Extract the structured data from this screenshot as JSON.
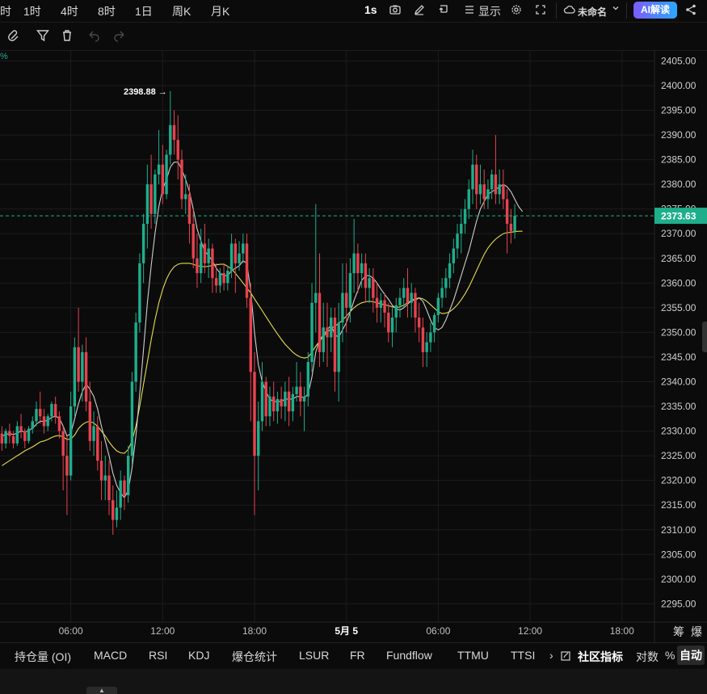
{
  "topbar": {
    "timeframes": [
      "时",
      "1时",
      "4时",
      "8时",
      "1日",
      "周K",
      "月K"
    ],
    "active_interval": "1s",
    "display_label": "显示",
    "layout_name": "未命名",
    "ai_label": "AI解读"
  },
  "bottombar": {
    "tabs": [
      "持仓量 (OI)",
      "MACD",
      "RSI",
      "KDJ",
      "爆仓统计",
      "LSUR",
      "FR",
      "Fundflow",
      "TTMU",
      "TTSI"
    ],
    "more_arrow": "›",
    "community_label": "社区指标",
    "log_label": "对数",
    "percent_label": "%",
    "auto_label": "自动",
    "extra_right": [
      "筹",
      "爆"
    ]
  },
  "colors": {
    "up": "#1fae8c",
    "down": "#e8424f",
    "ma_fast": "#cfcfcf",
    "ma_slow": "#e6dc4a",
    "price_line": "#1fae8c",
    "grid": "#1c1c1c",
    "background": "#0b0b0b"
  },
  "chart_data": {
    "type": "candlestick",
    "pct_marker": "%",
    "y_ticks": [
      2405.0,
      2400.0,
      2395.0,
      2390.0,
      2385.0,
      2380.0,
      2375.0,
      2370.0,
      2365.0,
      2360.0,
      2355.0,
      2350.0,
      2345.0,
      2340.0,
      2335.0,
      2330.0,
      2325.0,
      2320.0,
      2315.0,
      2310.0,
      2305.0,
      2300.0,
      2295.0
    ],
    "y_tick_labels": [
      "2405.00",
      "2400.00",
      "2395.00",
      "2390.00",
      "2385.00",
      "2380.00",
      "2375.00",
      "2370.00",
      "2365.00",
      "2360.00",
      "2355.00",
      "2350.00",
      "2345.00",
      "2340.00",
      "2335.00",
      "2330.00",
      "2325.00",
      "2320.00",
      "2315.00",
      "2310.00",
      "2305.00",
      "2300.00",
      "2295.00"
    ],
    "ylim": [
      2291.3,
      2407.2
    ],
    "x_tick_labels": [
      "06:00",
      "12:00",
      "18:00",
      "5月 5",
      "06:00",
      "12:00",
      "18:00"
    ],
    "x_tick_slots": [
      18,
      42,
      66,
      90,
      114,
      138,
      162
    ],
    "total_slots": 171,
    "current_price": 2373.63,
    "current_price_label": "2373.63",
    "high_marker": {
      "label": "2398.88 →",
      "slot": 44,
      "value": 2398.88
    },
    "candles": [
      {
        "o": 2329.5,
        "h": 2331.0,
        "c": 2327.5,
        "l": 2326.0
      },
      {
        "o": 2327.5,
        "h": 2330.5,
        "c": 2330.0,
        "l": 2326.5
      },
      {
        "o": 2330.0,
        "h": 2331.5,
        "c": 2329.0,
        "l": 2327.5
      },
      {
        "o": 2329.0,
        "h": 2330.0,
        "c": 2327.5,
        "l": 2326.5
      },
      {
        "o": 2327.5,
        "h": 2332.0,
        "c": 2331.0,
        "l": 2327.0
      },
      {
        "o": 2331.0,
        "h": 2333.5,
        "c": 2330.0,
        "l": 2328.5
      },
      {
        "o": 2330.0,
        "h": 2330.5,
        "c": 2328.0,
        "l": 2326.5
      },
      {
        "o": 2328.0,
        "h": 2331.0,
        "c": 2330.5,
        "l": 2327.5
      },
      {
        "o": 2330.5,
        "h": 2333.0,
        "c": 2332.0,
        "l": 2329.5
      },
      {
        "o": 2332.0,
        "h": 2336.0,
        "c": 2334.5,
        "l": 2331.0
      },
      {
        "o": 2334.5,
        "h": 2338.0,
        "c": 2333.0,
        "l": 2331.5
      },
      {
        "o": 2333.0,
        "h": 2334.5,
        "c": 2331.0,
        "l": 2329.5
      },
      {
        "o": 2331.0,
        "h": 2333.5,
        "c": 2333.0,
        "l": 2330.0
      },
      {
        "o": 2333.0,
        "h": 2336.0,
        "c": 2335.5,
        "l": 2332.0
      },
      {
        "o": 2335.5,
        "h": 2337.0,
        "c": 2333.0,
        "l": 2331.5
      },
      {
        "o": 2333.0,
        "h": 2334.0,
        "c": 2330.0,
        "l": 2328.5
      },
      {
        "o": 2330.0,
        "h": 2331.0,
        "c": 2325.0,
        "l": 2318.0
      },
      {
        "o": 2325.0,
        "h": 2329.0,
        "c": 2321.0,
        "l": 2313.0
      },
      {
        "o": 2321.0,
        "h": 2338.0,
        "c": 2335.0,
        "l": 2320.0
      },
      {
        "o": 2335.0,
        "h": 2349.0,
        "c": 2347.0,
        "l": 2333.0
      },
      {
        "o": 2347.0,
        "h": 2355.0,
        "c": 2340.0,
        "l": 2338.0
      },
      {
        "o": 2340.0,
        "h": 2347.5,
        "c": 2346.0,
        "l": 2336.0
      },
      {
        "o": 2346.0,
        "h": 2349.0,
        "c": 2336.0,
        "l": 2334.0
      },
      {
        "o": 2336.0,
        "h": 2340.0,
        "c": 2328.0,
        "l": 2326.0
      },
      {
        "o": 2328.0,
        "h": 2334.0,
        "c": 2331.0,
        "l": 2325.0
      },
      {
        "o": 2331.0,
        "h": 2333.0,
        "c": 2324.0,
        "l": 2322.0
      },
      {
        "o": 2324.0,
        "h": 2328.0,
        "c": 2320.0,
        "l": 2316.0
      },
      {
        "o": 2320.0,
        "h": 2325.0,
        "c": 2321.0,
        "l": 2316.0
      },
      {
        "o": 2321.0,
        "h": 2324.0,
        "c": 2316.0,
        "l": 2313.0
      },
      {
        "o": 2316.0,
        "h": 2319.0,
        "c": 2312.0,
        "l": 2309.0
      },
      {
        "o": 2312.0,
        "h": 2318.0,
        "c": 2314.5,
        "l": 2310.5
      },
      {
        "o": 2314.5,
        "h": 2322.0,
        "c": 2320.0,
        "l": 2312.0
      },
      {
        "o": 2320.0,
        "h": 2321.0,
        "c": 2317.0,
        "l": 2314.0
      },
      {
        "o": 2317.0,
        "h": 2327.0,
        "c": 2325.0,
        "l": 2315.5
      },
      {
        "o": 2325.0,
        "h": 2342.0,
        "c": 2340.0,
        "l": 2323.0
      },
      {
        "o": 2340.0,
        "h": 2354.0,
        "c": 2352.0,
        "l": 2338.0
      },
      {
        "o": 2352.0,
        "h": 2366.0,
        "c": 2364.0,
        "l": 2350.0
      },
      {
        "o": 2364.0,
        "h": 2374.0,
        "c": 2372.0,
        "l": 2360.0
      },
      {
        "o": 2372.0,
        "h": 2384.0,
        "c": 2380.0,
        "l": 2367.0
      },
      {
        "o": 2380.0,
        "h": 2386.0,
        "c": 2374.0,
        "l": 2371.0
      },
      {
        "o": 2374.0,
        "h": 2383.0,
        "c": 2382.0,
        "l": 2372.0
      },
      {
        "o": 2382.0,
        "h": 2391.0,
        "c": 2384.0,
        "l": 2380.0
      },
      {
        "o": 2384.0,
        "h": 2388.0,
        "c": 2378.0,
        "l": 2376.0
      },
      {
        "o": 2378.0,
        "h": 2387.0,
        "c": 2386.0,
        "l": 2377.0
      },
      {
        "o": 2386.0,
        "h": 2398.88,
        "c": 2392.0,
        "l": 2384.0
      },
      {
        "o": 2392.0,
        "h": 2395.0,
        "c": 2389.0,
        "l": 2386.0
      },
      {
        "o": 2389.0,
        "h": 2394.0,
        "c": 2385.0,
        "l": 2381.0
      },
      {
        "o": 2385.0,
        "h": 2387.0,
        "c": 2377.0,
        "l": 2375.0
      },
      {
        "o": 2377.0,
        "h": 2382.0,
        "c": 2378.0,
        "l": 2374.0
      },
      {
        "o": 2378.0,
        "h": 2380.0,
        "c": 2372.0,
        "l": 2368.0
      },
      {
        "o": 2372.0,
        "h": 2375.0,
        "c": 2365.0,
        "l": 2363.0
      },
      {
        "o": 2365.0,
        "h": 2370.0,
        "c": 2362.0,
        "l": 2359.0
      },
      {
        "o": 2362.0,
        "h": 2371.0,
        "c": 2368.0,
        "l": 2360.0
      },
      {
        "o": 2368.0,
        "h": 2372.0,
        "c": 2364.0,
        "l": 2362.0
      },
      {
        "o": 2364.0,
        "h": 2369.0,
        "c": 2367.0,
        "l": 2361.0
      },
      {
        "o": 2367.0,
        "h": 2368.0,
        "c": 2361.0,
        "l": 2358.0
      },
      {
        "o": 2361.0,
        "h": 2364.0,
        "c": 2359.5,
        "l": 2358.0
      },
      {
        "o": 2359.5,
        "h": 2363.0,
        "c": 2362.0,
        "l": 2358.0
      },
      {
        "o": 2362.0,
        "h": 2364.0,
        "c": 2360.0,
        "l": 2358.5
      },
      {
        "o": 2360.0,
        "h": 2363.5,
        "c": 2362.5,
        "l": 2358.5
      },
      {
        "o": 2362.5,
        "h": 2370.0,
        "c": 2368.0,
        "l": 2361.0
      },
      {
        "o": 2368.0,
        "h": 2369.0,
        "c": 2364.0,
        "l": 2358.0
      },
      {
        "o": 2364.0,
        "h": 2368.5,
        "c": 2366.0,
        "l": 2362.5
      },
      {
        "o": 2366.0,
        "h": 2370.0,
        "c": 2368.0,
        "l": 2364.0
      },
      {
        "o": 2368.0,
        "h": 2370.0,
        "c": 2357.0,
        "l": 2355.0
      },
      {
        "o": 2357.0,
        "h": 2360.0,
        "c": 2342.0,
        "l": 2332.0
      },
      {
        "o": 2342.0,
        "h": 2346.0,
        "c": 2325.0,
        "l": 2313.0
      },
      {
        "o": 2325.0,
        "h": 2336.0,
        "c": 2332.0,
        "l": 2318.0
      },
      {
        "o": 2332.0,
        "h": 2344.0,
        "c": 2340.0,
        "l": 2330.0
      },
      {
        "o": 2340.0,
        "h": 2341.0,
        "c": 2333.0,
        "l": 2331.0
      },
      {
        "o": 2333.0,
        "h": 2339.0,
        "c": 2337.0,
        "l": 2331.0
      },
      {
        "o": 2337.0,
        "h": 2340.0,
        "c": 2334.0,
        "l": 2332.0
      },
      {
        "o": 2334.0,
        "h": 2338.0,
        "c": 2336.5,
        "l": 2331.5
      },
      {
        "o": 2336.5,
        "h": 2339.0,
        "c": 2335.0,
        "l": 2332.5
      },
      {
        "o": 2335.0,
        "h": 2340.0,
        "c": 2338.0,
        "l": 2332.0
      },
      {
        "o": 2338.0,
        "h": 2341.0,
        "c": 2334.0,
        "l": 2331.0
      },
      {
        "o": 2334.0,
        "h": 2339.0,
        "c": 2337.5,
        "l": 2332.0
      },
      {
        "o": 2337.5,
        "h": 2344.0,
        "c": 2339.0,
        "l": 2336.0
      },
      {
        "o": 2339.0,
        "h": 2342.0,
        "c": 2336.0,
        "l": 2333.0
      },
      {
        "o": 2336.0,
        "h": 2339.0,
        "c": 2337.0,
        "l": 2330.0
      },
      {
        "o": 2337.0,
        "h": 2346.0,
        "c": 2344.0,
        "l": 2335.0
      },
      {
        "o": 2344.0,
        "h": 2360.0,
        "c": 2356.0,
        "l": 2342.0
      },
      {
        "o": 2356.0,
        "h": 2376.0,
        "c": 2358.0,
        "l": 2350.0
      },
      {
        "o": 2358.0,
        "h": 2366.0,
        "c": 2346.0,
        "l": 2343.0
      },
      {
        "o": 2346.0,
        "h": 2356.0,
        "c": 2351.0,
        "l": 2344.0
      },
      {
        "o": 2351.0,
        "h": 2356.0,
        "c": 2349.0,
        "l": 2343.0
      },
      {
        "o": 2349.0,
        "h": 2355.0,
        "c": 2353.0,
        "l": 2346.0
      },
      {
        "o": 2353.0,
        "h": 2355.0,
        "c": 2342.0,
        "l": 2338.0
      },
      {
        "o": 2342.0,
        "h": 2356.0,
        "c": 2352.0,
        "l": 2336.0
      },
      {
        "o": 2352.0,
        "h": 2364.0,
        "c": 2358.0,
        "l": 2348.0
      },
      {
        "o": 2358.0,
        "h": 2364.0,
        "c": 2355.0,
        "l": 2350.0
      },
      {
        "o": 2355.0,
        "h": 2365.0,
        "c": 2362.0,
        "l": 2352.0
      },
      {
        "o": 2362.0,
        "h": 2373.0,
        "c": 2366.0,
        "l": 2358.0
      },
      {
        "o": 2366.0,
        "h": 2368.0,
        "c": 2362.0,
        "l": 2358.0
      },
      {
        "o": 2362.0,
        "h": 2366.0,
        "c": 2364.0,
        "l": 2359.0
      },
      {
        "o": 2364.0,
        "h": 2366.0,
        "c": 2359.0,
        "l": 2356.0
      },
      {
        "o": 2359.0,
        "h": 2363.0,
        "c": 2361.0,
        "l": 2356.0
      },
      {
        "o": 2361.0,
        "h": 2363.0,
        "c": 2357.0,
        "l": 2354.0
      },
      {
        "o": 2357.0,
        "h": 2360.0,
        "c": 2355.0,
        "l": 2352.0
      },
      {
        "o": 2355.0,
        "h": 2358.0,
        "c": 2356.5,
        "l": 2352.0
      },
      {
        "o": 2356.5,
        "h": 2358.0,
        "c": 2354.0,
        "l": 2351.0
      },
      {
        "o": 2354.0,
        "h": 2356.0,
        "c": 2350.0,
        "l": 2348.0
      },
      {
        "o": 2350.0,
        "h": 2355.0,
        "c": 2353.0,
        "l": 2347.0
      },
      {
        "o": 2353.0,
        "h": 2357.0,
        "c": 2355.5,
        "l": 2350.0
      },
      {
        "o": 2355.5,
        "h": 2359.0,
        "c": 2357.0,
        "l": 2353.0
      },
      {
        "o": 2357.0,
        "h": 2361.0,
        "c": 2359.0,
        "l": 2355.0
      },
      {
        "o": 2359.0,
        "h": 2363.0,
        "c": 2356.0,
        "l": 2353.0
      },
      {
        "o": 2356.0,
        "h": 2360.0,
        "c": 2358.0,
        "l": 2353.0
      },
      {
        "o": 2358.0,
        "h": 2359.0,
        "c": 2353.0,
        "l": 2350.0
      },
      {
        "o": 2353.0,
        "h": 2356.0,
        "c": 2351.0,
        "l": 2348.0
      },
      {
        "o": 2351.0,
        "h": 2353.0,
        "c": 2346.0,
        "l": 2343.0
      },
      {
        "o": 2346.0,
        "h": 2350.0,
        "c": 2348.0,
        "l": 2343.0
      },
      {
        "o": 2348.0,
        "h": 2352.0,
        "c": 2350.0,
        "l": 2346.0
      },
      {
        "o": 2350.0,
        "h": 2354.0,
        "c": 2353.5,
        "l": 2348.0
      },
      {
        "o": 2353.5,
        "h": 2358.0,
        "c": 2357.0,
        "l": 2352.0
      },
      {
        "o": 2357.0,
        "h": 2361.0,
        "c": 2359.0,
        "l": 2355.0
      },
      {
        "o": 2359.0,
        "h": 2363.0,
        "c": 2361.0,
        "l": 2357.0
      },
      {
        "o": 2361.0,
        "h": 2366.0,
        "c": 2364.0,
        "l": 2359.0
      },
      {
        "o": 2364.0,
        "h": 2369.0,
        "c": 2367.0,
        "l": 2362.0
      },
      {
        "o": 2367.0,
        "h": 2372.0,
        "c": 2370.0,
        "l": 2365.0
      },
      {
        "o": 2370.0,
        "h": 2375.0,
        "c": 2372.0,
        "l": 2366.0
      },
      {
        "o": 2372.0,
        "h": 2377.0,
        "c": 2375.0,
        "l": 2370.0
      },
      {
        "o": 2375.0,
        "h": 2381.0,
        "c": 2379.0,
        "l": 2373.0
      },
      {
        "o": 2379.0,
        "h": 2387.0,
        "c": 2384.0,
        "l": 2376.0
      },
      {
        "o": 2384.0,
        "h": 2386.0,
        "c": 2378.0,
        "l": 2375.0
      },
      {
        "o": 2378.0,
        "h": 2384.0,
        "c": 2380.0,
        "l": 2376.0
      },
      {
        "o": 2380.0,
        "h": 2383.0,
        "c": 2377.0,
        "l": 2375.0
      },
      {
        "o": 2377.0,
        "h": 2381.0,
        "c": 2379.0,
        "l": 2375.0
      },
      {
        "o": 2379.0,
        "h": 2383.0,
        "c": 2382.0,
        "l": 2377.0
      },
      {
        "o": 2382.0,
        "h": 2390.0,
        "c": 2378.0,
        "l": 2376.0
      },
      {
        "o": 2378.0,
        "h": 2383.0,
        "c": 2380.0,
        "l": 2376.0
      },
      {
        "o": 2380.0,
        "h": 2383.0,
        "c": 2377.0,
        "l": 2375.0
      },
      {
        "o": 2377.0,
        "h": 2379.0,
        "c": 2372.0,
        "l": 2366.0
      },
      {
        "o": 2372.0,
        "h": 2375.0,
        "c": 2370.5,
        "l": 2368.0
      },
      {
        "o": 2370.5,
        "h": 2376.0,
        "c": 2373.63,
        "l": 2369.0
      }
    ],
    "ma_fast": [
      2329.0,
      2329.3,
      2329.5,
      2329.3,
      2329.6,
      2330.0,
      2329.8,
      2330.1,
      2330.6,
      2331.4,
      2332.0,
      2332.0,
      2332.2,
      2332.8,
      2333.0,
      2332.6,
      2331.0,
      2329.0,
      2329.5,
      2332.5,
      2335.5,
      2338.0,
      2339.5,
      2338.5,
      2337.0,
      2334.5,
      2331.0,
      2328.0,
      2325.0,
      2321.5,
      2319.0,
      2317.5,
      2316.5,
      2318.0,
      2322.5,
      2329.0,
      2337.5,
      2346.5,
      2356.0,
      2363.5,
      2370.0,
      2375.5,
      2379.0,
      2381.0,
      2383.5,
      2384.5,
      2384.5,
      2383.0,
      2381.0,
      2378.5,
      2375.0,
      2371.0,
      2368.5,
      2366.5,
      2365.5,
      2364.5,
      2363.0,
      2362.0,
      2361.5,
      2361.5,
      2362.5,
      2363.0,
      2363.5,
      2364.5,
      2364.0,
      2358.5,
      2350.0,
      2343.5,
      2340.0,
      2338.0,
      2336.5,
      2336.0,
      2336.0,
      2336.0,
      2336.5,
      2336.5,
      2336.5,
      2337.0,
      2337.0,
      2336.8,
      2337.5,
      2341.0,
      2346.0,
      2348.5,
      2349.5,
      2350.5,
      2351.5,
      2349.5,
      2349.0,
      2350.5,
      2352.0,
      2354.0,
      2356.5,
      2358.5,
      2360.5,
      2361.5,
      2361.5,
      2361.0,
      2360.0,
      2358.8,
      2357.7,
      2356.7,
      2355.5,
      2354.8,
      2354.5,
      2355.0,
      2355.7,
      2356.5,
      2356.5,
      2357.0,
      2356.3,
      2354.5,
      2352.5,
      2351.0,
      2350.5,
      2351.0,
      2352.5,
      2354.5,
      2356.5,
      2359.0,
      2361.5,
      2364.0,
      2366.5,
      2369.5,
      2372.5,
      2375.0,
      2376.5,
      2378.0,
      2378.5,
      2379.0,
      2379.5,
      2380.0,
      2379.5,
      2378.5,
      2377.0,
      2375.5,
      2374.5
    ],
    "ma_slow": [
      2323.0,
      2323.5,
      2324.0,
      2324.5,
      2325.0,
      2325.5,
      2326.0,
      2326.4,
      2326.8,
      2327.3,
      2327.8,
      2328.0,
      2328.3,
      2328.7,
      2329.0,
      2329.1,
      2328.8,
      2328.3,
      2328.4,
      2329.2,
      2330.5,
      2331.3,
      2331.8,
      2332.0,
      2331.6,
      2331.0,
      2330.0,
      2329.0,
      2327.8,
      2326.8,
      2326.0,
      2325.6,
      2325.5,
      2326.3,
      2328.0,
      2331.0,
      2335.0,
      2339.5,
      2344.0,
      2348.5,
      2352.5,
      2356.0,
      2358.7,
      2360.8,
      2362.3,
      2363.3,
      2363.8,
      2364.0,
      2364.0,
      2364.0,
      2363.8,
      2363.5,
      2363.4,
      2363.3,
      2363.4,
      2363.6,
      2363.7,
      2363.8,
      2363.8,
      2363.4,
      2362.8,
      2362.0,
      2361.0,
      2360.0,
      2359.0,
      2358.0,
      2356.8,
      2355.6,
      2354.4,
      2353.2,
      2352.0,
      2350.8,
      2349.7,
      2348.6,
      2347.6,
      2346.8,
      2346.0,
      2345.4,
      2345.0,
      2344.8,
      2345.0,
      2346.0,
      2347.2,
      2348.2,
      2349.2,
      2350.0,
      2350.8,
      2351.3,
      2351.8,
      2352.5,
      2353.3,
      2354.2,
      2355.0,
      2355.6,
      2356.0,
      2356.2,
      2356.3,
      2356.2,
      2356.0,
      2355.8,
      2355.6,
      2355.4,
      2355.2,
      2355.0,
      2355.2,
      2355.5,
      2356.0,
      2356.5,
      2356.8,
      2357.0,
      2356.8,
      2356.3,
      2355.6,
      2354.9,
      2354.2,
      2353.8,
      2353.9,
      2354.2,
      2354.8,
      2355.6,
      2356.6,
      2357.8,
      2359.2,
      2360.8,
      2362.5,
      2364.2,
      2365.8,
      2367.1,
      2368.1,
      2368.9,
      2369.5,
      2370.0,
      2370.2,
      2370.3,
      2370.4,
      2370.5,
      2370.5
    ]
  }
}
